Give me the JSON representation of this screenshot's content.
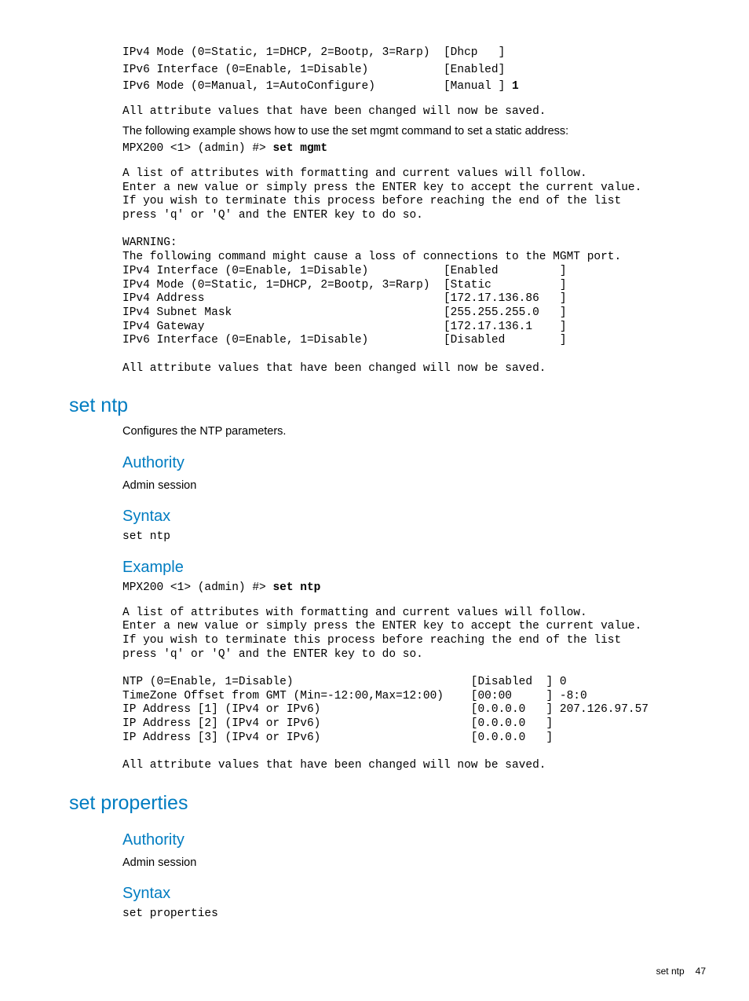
{
  "topBlock": {
    "l1": "IPv4 Mode (0=Static, 1=DHCP, 2=Bootp, 3=Rarp)  [Dhcp   ]",
    "l2": "IPv6 Interface (0=Enable, 1=Disable)           [Enabled]",
    "l3_pre": "IPv6 Mode (0=Manual, 1=AutoConfigure)          [Manual ] ",
    "l3_bold": "1",
    "saved": "All attribute values that have been changed will now be saved."
  },
  "staticIntro": "The following example shows how to use the set mgmt command to set a static address:",
  "staticCmd": {
    "pre": "MPX200 <1> (admin) #> ",
    "bold": "set mgmt"
  },
  "staticBlock": "A list of attributes with formatting and current values will follow.\nEnter a new value or simply press the ENTER key to accept the current value.\nIf you wish to terminate this process before reaching the end of the list\npress 'q' or 'Q' and the ENTER key to do so.\n\nWARNING:\nThe following command might cause a loss of connections to the MGMT port.\nIPv4 Interface (0=Enable, 1=Disable)           [Enabled         ]\nIPv4 Mode (0=Static, 1=DHCP, 2=Bootp, 3=Rarp)  [Static          ]\nIPv4 Address                                   [172.17.136.86   ]\nIPv4 Subnet Mask                               [255.255.255.0   ]\nIPv4 Gateway                                   [172.17.136.1    ]\nIPv6 Interface (0=Enable, 1=Disable)           [Disabled        ]\n\nAll attribute values that have been changed will now be saved.",
  "setNtp": {
    "heading": "set ntp",
    "desc": "Configures the NTP parameters.",
    "authHeading": "Authority",
    "authText": "Admin session",
    "syntaxHeading": "Syntax",
    "syntaxText": "set ntp",
    "exampleHeading": "Example",
    "exampleCmd": {
      "pre": "MPX200 <1> (admin) #> ",
      "bold": "set ntp"
    },
    "exampleBlock": "A list of attributes with formatting and current values will follow.\nEnter a new value or simply press the ENTER key to accept the current value.\nIf you wish to terminate this process before reaching the end of the list\npress 'q' or 'Q' and the ENTER key to do so.\n\nNTP (0=Enable, 1=Disable)                          [Disabled  ] 0\nTimeZone Offset from GMT (Min=-12:00,Max=12:00)    [00:00     ] -8:0\nIP Address [1] (IPv4 or IPv6)                      [0.0.0.0   ] 207.126.97.57\nIP Address [2] (IPv4 or IPv6)                      [0.0.0.0   ]\nIP Address [3] (IPv4 or IPv6)                      [0.0.0.0   ]\n\nAll attribute values that have been changed will now be saved."
  },
  "setProps": {
    "heading": "set properties",
    "authHeading": "Authority",
    "authText": "Admin session",
    "syntaxHeading": "Syntax",
    "syntaxText": "set properties"
  },
  "footer": {
    "section": "set ntp",
    "page": "47"
  }
}
